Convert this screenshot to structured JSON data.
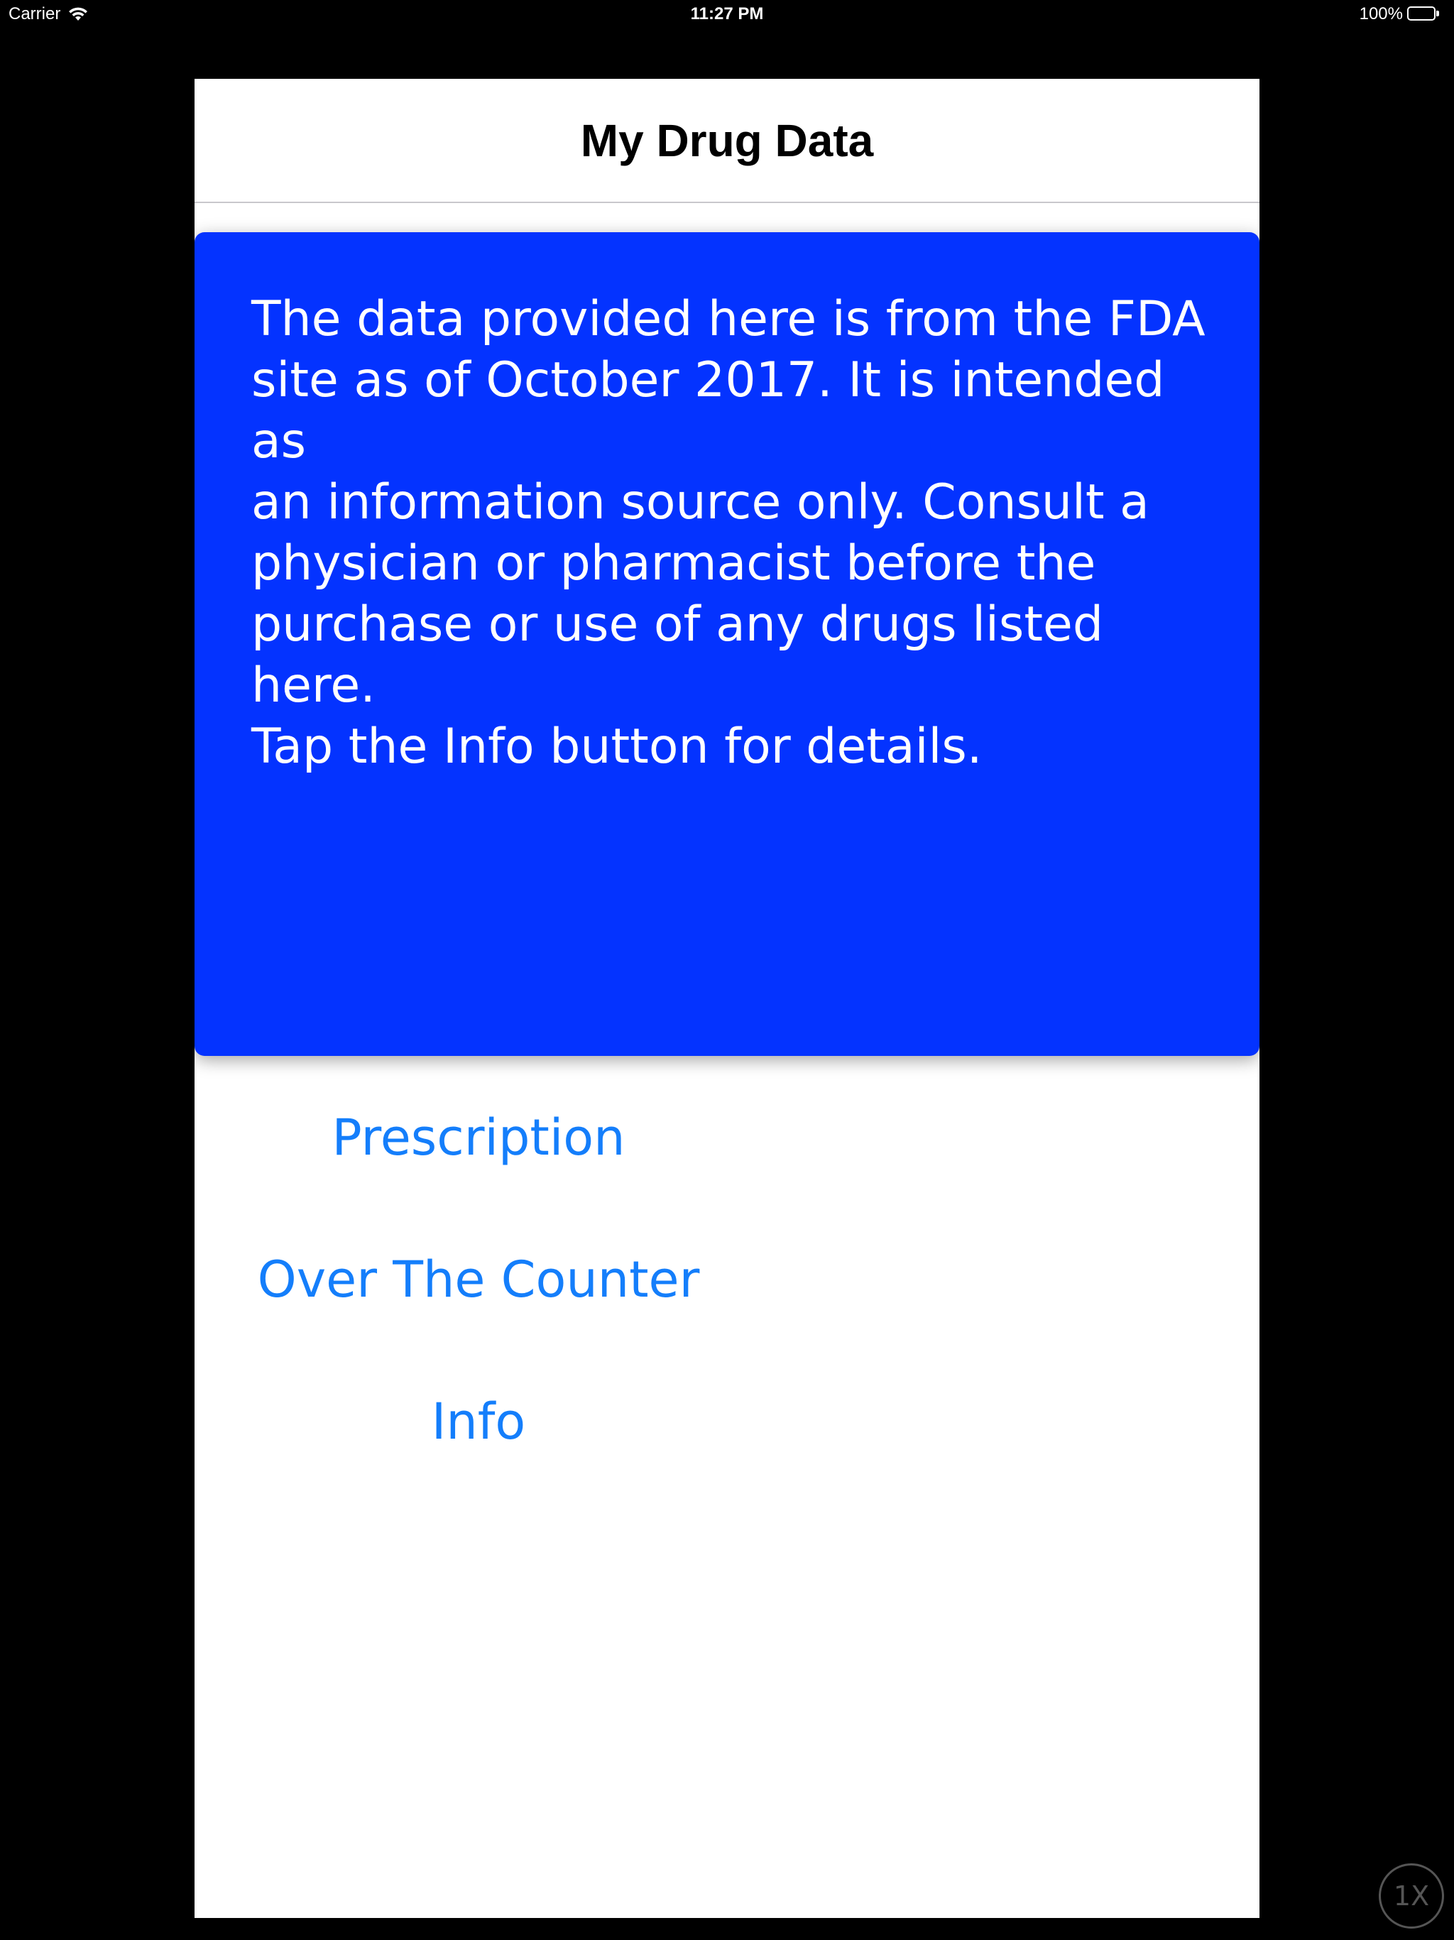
{
  "status_bar": {
    "carrier": "Carrier",
    "time": "11:27 PM",
    "battery": "100%",
    "wifi_icon": "wifi-icon",
    "battery_icon": "battery-icon"
  },
  "nav": {
    "title": "My Drug Data"
  },
  "notice": {
    "text": "The data provided here is from the FDA\nsite as of October 2017. It is intended as\nan information source only. Consult a\nphysician or pharmacist before the\npurchase or use of any drugs listed here.\nTap the Info button for details.",
    "background_color": "#0433ff"
  },
  "menu": {
    "prescription_label": "Prescription",
    "otc_label": "Over The Counter",
    "info_label": "Info",
    "link_color": "#147efb"
  },
  "zoom": {
    "label": "1X"
  }
}
